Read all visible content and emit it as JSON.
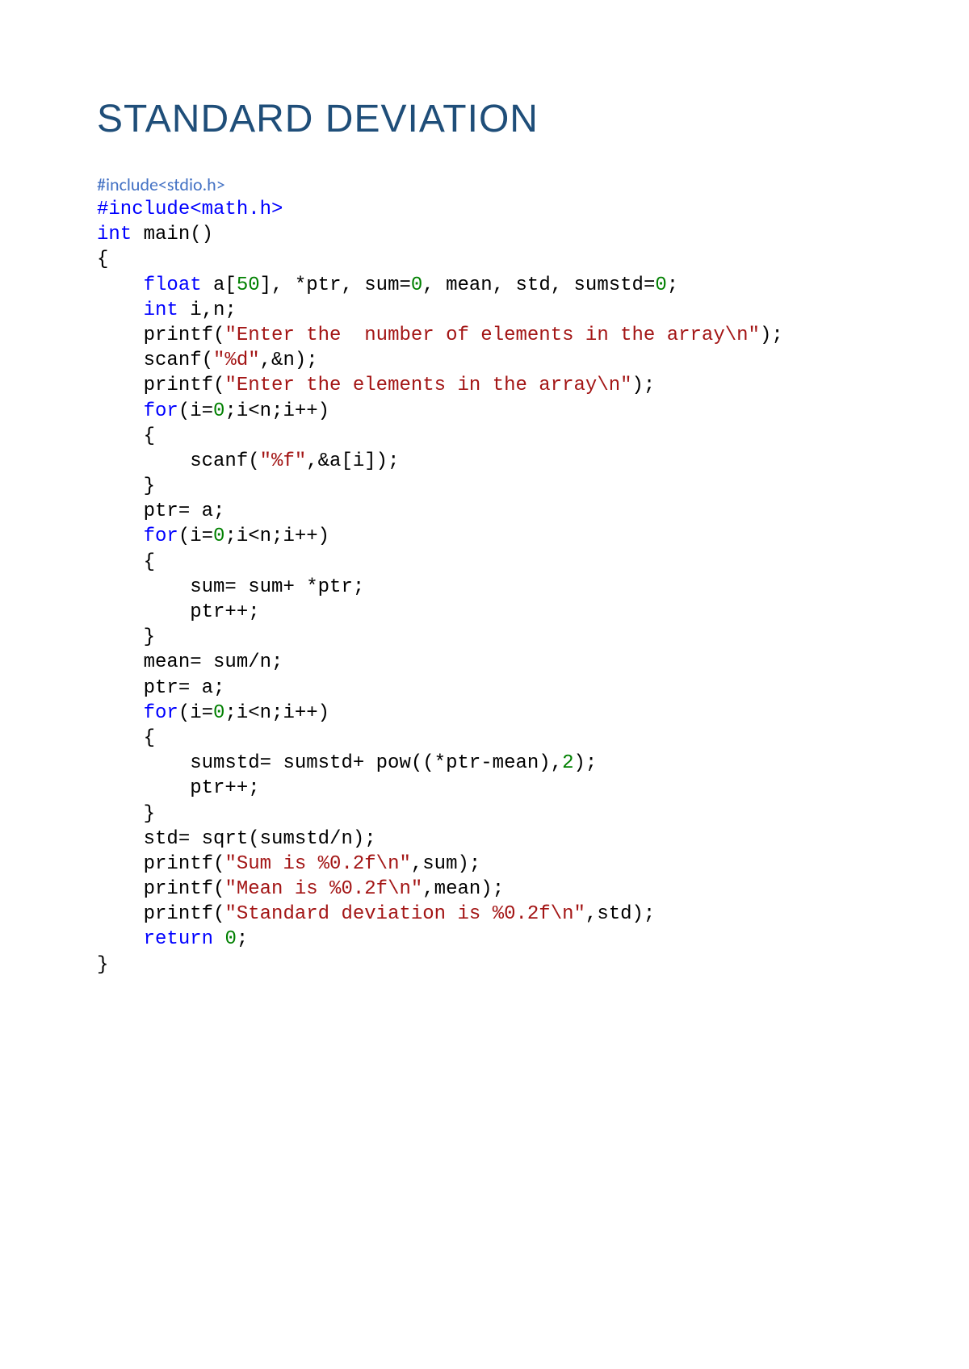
{
  "title": "STANDARD DEVIATION",
  "subtitle": "#include<stdio.h>",
  "code": {
    "tokens": [
      {
        "t": "#include<math.h>",
        "c": "kw"
      },
      {
        "t": "\n"
      },
      {
        "t": "int",
        "c": "kw"
      },
      {
        "t": " main()\n"
      },
      {
        "t": "{\n"
      },
      {
        "t": "    "
      },
      {
        "t": "float",
        "c": "kw"
      },
      {
        "t": " a["
      },
      {
        "t": "50",
        "c": "num"
      },
      {
        "t": "], *ptr, sum="
      },
      {
        "t": "0",
        "c": "num"
      },
      {
        "t": ", mean, std, sumstd="
      },
      {
        "t": "0",
        "c": "num"
      },
      {
        "t": ";\n"
      },
      {
        "t": "    "
      },
      {
        "t": "int",
        "c": "kw"
      },
      {
        "t": " i,n;\n"
      },
      {
        "t": "    printf("
      },
      {
        "t": "\"Enter the  number of elements in the array\\n\"",
        "c": "str"
      },
      {
        "t": ");\n"
      },
      {
        "t": "    scanf("
      },
      {
        "t": "\"%d\"",
        "c": "str"
      },
      {
        "t": ",&n);\n"
      },
      {
        "t": "    printf("
      },
      {
        "t": "\"Enter the elements in the array\\n\"",
        "c": "str"
      },
      {
        "t": ");\n"
      },
      {
        "t": "    "
      },
      {
        "t": "for",
        "c": "kw"
      },
      {
        "t": "(i="
      },
      {
        "t": "0",
        "c": "num"
      },
      {
        "t": ";i<n;i++)\n"
      },
      {
        "t": "    {\n"
      },
      {
        "t": "        scanf("
      },
      {
        "t": "\"%f\"",
        "c": "str"
      },
      {
        "t": ",&a[i]);\n"
      },
      {
        "t": "    }\n"
      },
      {
        "t": "    ptr= a;\n"
      },
      {
        "t": "    "
      },
      {
        "t": "for",
        "c": "kw"
      },
      {
        "t": "(i="
      },
      {
        "t": "0",
        "c": "num"
      },
      {
        "t": ";i<n;i++)\n"
      },
      {
        "t": "    {\n"
      },
      {
        "t": "        sum= sum+ *ptr;\n"
      },
      {
        "t": "        ptr++;\n"
      },
      {
        "t": "    }\n"
      },
      {
        "t": "    mean= sum/n;\n"
      },
      {
        "t": "    ptr= a;\n"
      },
      {
        "t": "    "
      },
      {
        "t": "for",
        "c": "kw"
      },
      {
        "t": "(i="
      },
      {
        "t": "0",
        "c": "num"
      },
      {
        "t": ";i<n;i++)\n"
      },
      {
        "t": "    {\n"
      },
      {
        "t": "        sumstd= sumstd+ pow((*ptr-mean),"
      },
      {
        "t": "2",
        "c": "num"
      },
      {
        "t": ");\n"
      },
      {
        "t": "        ptr++;\n"
      },
      {
        "t": "    }\n"
      },
      {
        "t": "    std= sqrt(sumstd/n);\n"
      },
      {
        "t": "    printf("
      },
      {
        "t": "\"Sum is %0.2f\\n\"",
        "c": "str"
      },
      {
        "t": ",sum);\n"
      },
      {
        "t": "    printf("
      },
      {
        "t": "\"Mean is %0.2f\\n\"",
        "c": "str"
      },
      {
        "t": ",mean);\n"
      },
      {
        "t": "    printf("
      },
      {
        "t": "\"Standard deviation is %0.2f\\n\"",
        "c": "str"
      },
      {
        "t": ",std);\n"
      },
      {
        "t": "    "
      },
      {
        "t": "return",
        "c": "kw"
      },
      {
        "t": " "
      },
      {
        "t": "0",
        "c": "num"
      },
      {
        "t": ";\n"
      },
      {
        "t": "}\n"
      }
    ]
  }
}
